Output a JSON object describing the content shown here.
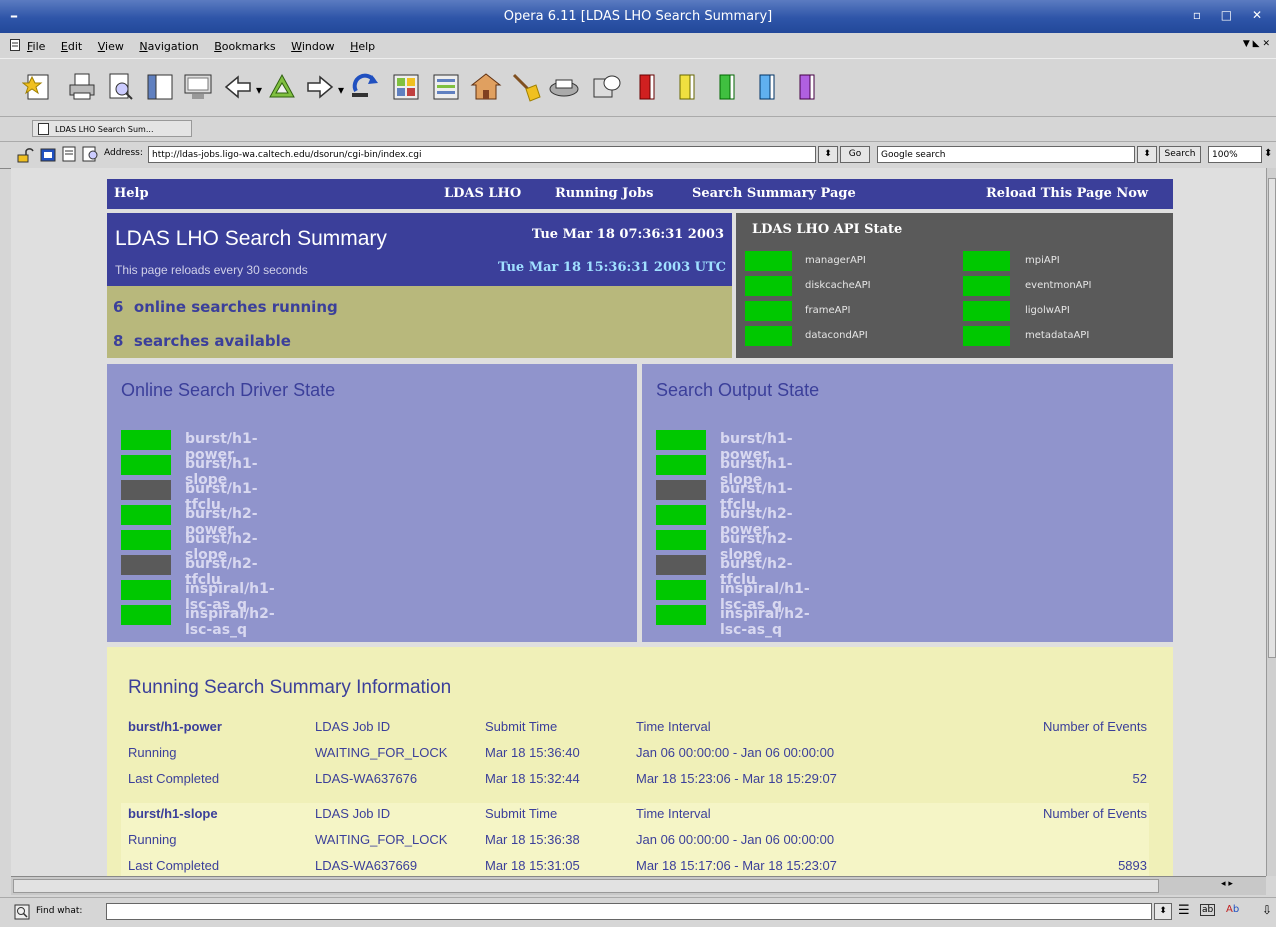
{
  "window": {
    "title": "Opera 6.11  [LDAS LHO Search Summary]",
    "menu_symbol": "–",
    "controls": "▫ □ ✕"
  },
  "menu": [
    "File",
    "Edit",
    "View",
    "Navigation",
    "Bookmarks",
    "Window",
    "Help"
  ],
  "tab": {
    "label": "LDAS LHO Search Sum..."
  },
  "address": {
    "label": "Address:",
    "url": "http://ldas-jobs.ligo-wa.caltech.edu/dsorun/cgi-bin/index.cgi",
    "go": "Go",
    "search_engine": "Google search",
    "search_button": "Search",
    "zoom": "100%"
  },
  "find": {
    "label": "Find what:"
  },
  "nav": {
    "help": "Help",
    "lho": "LDAS LHO",
    "running": "Running Jobs",
    "summary": "Search Summary Page",
    "reload": "Reload This Page Now"
  },
  "summary": {
    "title": "LDAS LHO Search Summary",
    "reload_note": "This page reloads every 30 seconds",
    "local_time": "Tue Mar 18 07:36:31 2003",
    "utc_time": "Tue Mar 18 15:36:31 2003 UTC",
    "online_count": "6",
    "online_label": "online searches running",
    "available_count": "8",
    "available_label": "searches available"
  },
  "api_state": {
    "title": "LDAS LHO API State",
    "apis": [
      {
        "name": "managerAPI",
        "status_color": "#00c800"
      },
      {
        "name": "mpiAPI",
        "status_color": "#00c800"
      },
      {
        "name": "diskcacheAPI",
        "status_color": "#00c800"
      },
      {
        "name": "eventmonAPI",
        "status_color": "#00c800"
      },
      {
        "name": "frameAPI",
        "status_color": "#00c800"
      },
      {
        "name": "ligolwAPI",
        "status_color": "#00c800"
      },
      {
        "name": "datacondAPI",
        "status_color": "#00c800"
      },
      {
        "name": "metadataAPI",
        "status_color": "#00c800"
      }
    ]
  },
  "driver_state": {
    "title": "Online Search Driver State",
    "items": [
      {
        "name": "burst/h1-power",
        "status_color": "#00c800"
      },
      {
        "name": "burst/h1-slope",
        "status_color": "#00c800"
      },
      {
        "name": "burst/h1-tfclu",
        "status_color": "#5a5a5a"
      },
      {
        "name": "burst/h2-power",
        "status_color": "#00c800"
      },
      {
        "name": "burst/h2-slope",
        "status_color": "#00c800"
      },
      {
        "name": "burst/h2-tfclu",
        "status_color": "#5a5a5a"
      },
      {
        "name": "inspiral/h1-lsc-as_q",
        "status_color": "#00c800"
      },
      {
        "name": "inspiral/h2-lsc-as_q",
        "status_color": "#00c800"
      }
    ]
  },
  "output_state": {
    "title": "Search Output State",
    "items": [
      {
        "name": "burst/h1-power",
        "status_color": "#00c800"
      },
      {
        "name": "burst/h1-slope",
        "status_color": "#00c800"
      },
      {
        "name": "burst/h1-tfclu",
        "status_color": "#5a5a5a"
      },
      {
        "name": "burst/h2-power",
        "status_color": "#00c800"
      },
      {
        "name": "burst/h2-slope",
        "status_color": "#00c800"
      },
      {
        "name": "burst/h2-tfclu",
        "status_color": "#5a5a5a"
      },
      {
        "name": "inspiral/h1-lsc-as_q",
        "status_color": "#00c800"
      },
      {
        "name": "inspiral/h2-lsc-as_q",
        "status_color": "#00c800"
      }
    ]
  },
  "running": {
    "title": "Running Search Summary Information",
    "headers": {
      "job": "LDAS Job ID",
      "submit": "Submit Time",
      "interval": "Time Interval",
      "events": "Number of Events"
    },
    "searches": [
      {
        "name": "burst/h1-power",
        "running": {
          "label": "Running",
          "job": "WAITING_FOR_LOCK",
          "submit": "Mar 18 15:36:40",
          "interval": "Jan 06 00:00:00  - Jan 06 00:00:00",
          "events": ""
        },
        "last": {
          "label": "Last Completed",
          "job": "LDAS-WA637676",
          "submit": "Mar 18 15:32:44",
          "interval": "Mar 18 15:23:06  - Mar 18 15:29:07",
          "events": "52"
        }
      },
      {
        "name": "burst/h1-slope",
        "running": {
          "label": "Running",
          "job": "WAITING_FOR_LOCK",
          "submit": "Mar 18 15:36:38",
          "interval": "Jan 06 00:00:00  - Jan 06 00:00:00",
          "events": ""
        },
        "last": {
          "label": "Last Completed",
          "job": "LDAS-WA637669",
          "submit": "Mar 18 15:31:05",
          "interval": "Mar 18 15:17:06  - Mar 18 15:23:07",
          "events": "5893"
        }
      }
    ]
  }
}
